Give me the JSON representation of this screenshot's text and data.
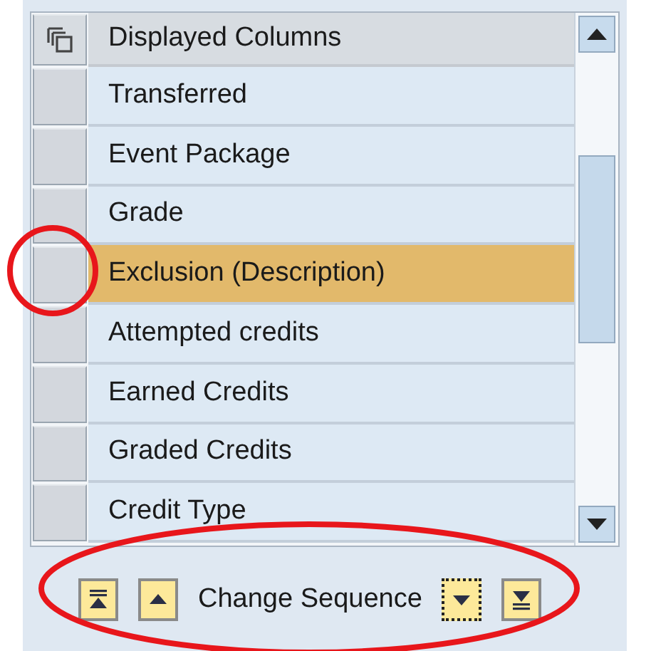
{
  "table": {
    "header": "Displayed Columns",
    "rows": [
      {
        "label": "Transferred",
        "selected": false
      },
      {
        "label": "Event Package",
        "selected": false
      },
      {
        "label": "Grade",
        "selected": false
      },
      {
        "label": "Exclusion (Description)",
        "selected": true
      },
      {
        "label": "Attempted credits",
        "selected": false
      },
      {
        "label": "Earned Credits",
        "selected": false
      },
      {
        "label": "Graded Credits",
        "selected": false
      },
      {
        "label": "Credit Type",
        "selected": false
      }
    ]
  },
  "sequence": {
    "label": "Change Sequence",
    "buttons": [
      {
        "kind": "top",
        "focused": false
      },
      {
        "kind": "up",
        "focused": false
      },
      {
        "kind": "down",
        "focused": true
      },
      {
        "kind": "bottom",
        "focused": false
      }
    ]
  }
}
